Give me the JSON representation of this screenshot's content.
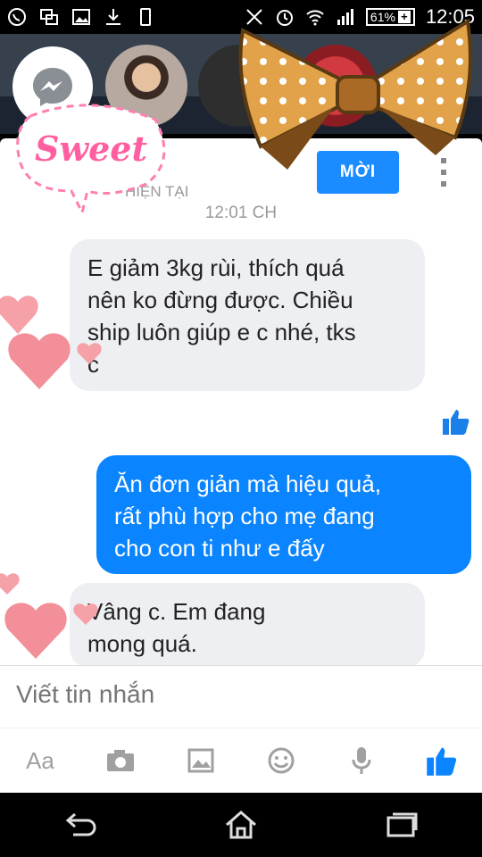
{
  "status_bar": {
    "battery": "61%",
    "time": "12:05"
  },
  "chat": {
    "invite_label": "MỜI",
    "presence": "HIỆN TẠI",
    "timestamp": "12:01 CH",
    "messages": [
      {
        "from": "them",
        "text": "E giảm 3kg rùi, thích quá\nnên ko đừng được. Chiều\nship luôn giúp e c nhé, tks\nc"
      },
      {
        "from": "me",
        "text": "Ăn đơn giản mà hiệu quả,\nrất phù hợp cho mẹ đang\ncho con ti như e đấy"
      },
      {
        "from": "them",
        "text": "Vâng c. Em đang\nmong quá."
      }
    ]
  },
  "compose": {
    "placeholder": "Viết tin nhắn"
  },
  "toolbar": {
    "aa_label": "Aa",
    "icons": [
      "text-format-icon",
      "camera-icon",
      "gallery-icon",
      "emoji-icon",
      "microphone-icon",
      "like-icon"
    ]
  },
  "decoration": {
    "sticker_text": "Sweet"
  },
  "colors": {
    "accent": "#0a84ff",
    "invite": "#1a8cff",
    "incoming_bubble": "#eeeff2"
  }
}
